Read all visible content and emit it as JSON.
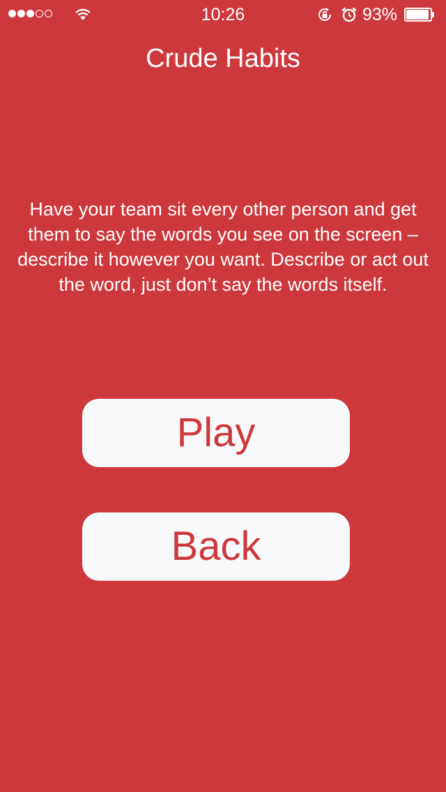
{
  "status_bar": {
    "signal_filled": 3,
    "signal_total": 5,
    "wifi_icon": "wifi-icon",
    "time": "10:26",
    "rotation_lock_icon": "rotation-lock-icon",
    "alarm_icon": "alarm-icon",
    "battery_percent_label": "93%",
    "battery_level": 0.93,
    "battery_icon": "battery-icon"
  },
  "screen": {
    "title": "Crude Habits",
    "instructions": "Have your team sit every other person and get them to say the words you see on the screen – describe it however you want. Describe or act out the word, just don’t say the words itself.",
    "play_label": "Play",
    "back_label": "Back"
  },
  "colors": {
    "background": "#cd383c",
    "button_bg": "#f8f9fb",
    "button_text": "#cd383c",
    "text": "#ffffff"
  }
}
